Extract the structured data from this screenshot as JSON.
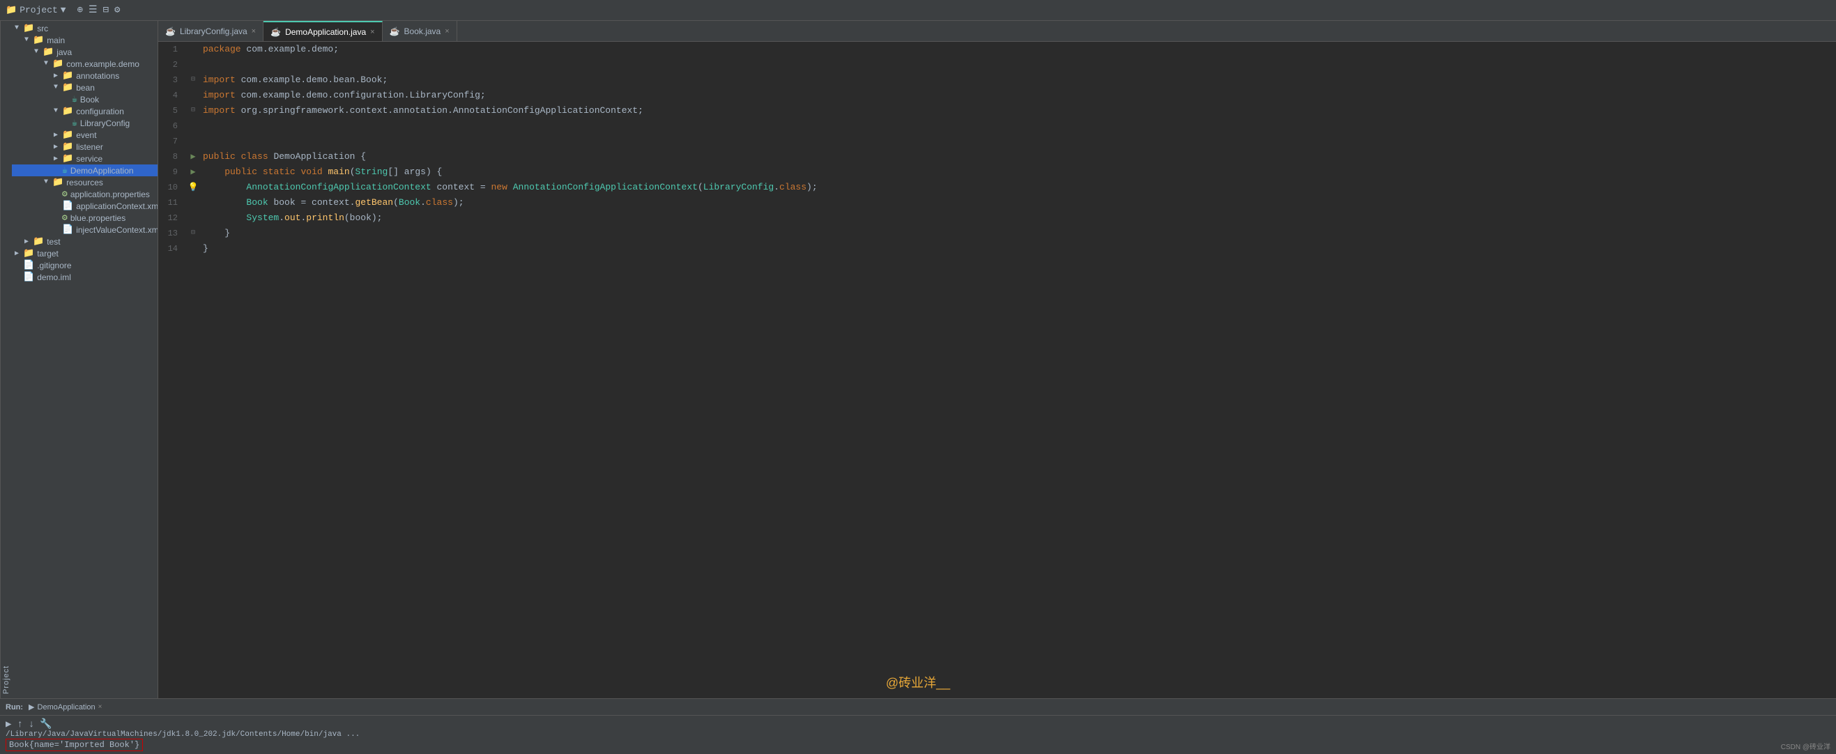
{
  "titleBar": {
    "projectLabel": "Project",
    "dropdownIcon": "▼",
    "icons": [
      "⊕",
      "≡",
      "≠",
      "⚙"
    ]
  },
  "sidebar": {
    "verticalLabel": "Project",
    "tree": [
      {
        "id": "src",
        "label": "src",
        "type": "folder-src",
        "depth": 0,
        "expanded": true,
        "arrow": "▼"
      },
      {
        "id": "main",
        "label": "main",
        "type": "folder",
        "depth": 1,
        "expanded": true,
        "arrow": "▼"
      },
      {
        "id": "java",
        "label": "java",
        "type": "folder",
        "depth": 2,
        "expanded": true,
        "arrow": "▼"
      },
      {
        "id": "com.example.demo",
        "label": "com.example.demo",
        "type": "folder",
        "depth": 3,
        "expanded": true,
        "arrow": "▼"
      },
      {
        "id": "annotations",
        "label": "annotations",
        "type": "folder",
        "depth": 4,
        "expanded": false,
        "arrow": "▶"
      },
      {
        "id": "bean",
        "label": "bean",
        "type": "folder",
        "depth": 4,
        "expanded": true,
        "arrow": "▼"
      },
      {
        "id": "Book",
        "label": "Book",
        "type": "java",
        "depth": 5,
        "expanded": false,
        "arrow": ""
      },
      {
        "id": "configuration",
        "label": "configuration",
        "type": "folder",
        "depth": 4,
        "expanded": true,
        "arrow": "▼"
      },
      {
        "id": "LibraryConfig",
        "label": "LibraryConfig",
        "type": "java",
        "depth": 5,
        "expanded": false,
        "arrow": ""
      },
      {
        "id": "event",
        "label": "event",
        "type": "folder",
        "depth": 4,
        "expanded": false,
        "arrow": "▶"
      },
      {
        "id": "listener",
        "label": "listener",
        "type": "folder",
        "depth": 4,
        "expanded": false,
        "arrow": "▶"
      },
      {
        "id": "service",
        "label": "service",
        "type": "folder",
        "depth": 4,
        "expanded": false,
        "arrow": "▶"
      },
      {
        "id": "DemoApplication",
        "label": "DemoApplication",
        "type": "java",
        "depth": 4,
        "expanded": false,
        "arrow": "",
        "selected": true
      },
      {
        "id": "resources",
        "label": "resources",
        "type": "folder-res",
        "depth": 3,
        "expanded": true,
        "arrow": "▼"
      },
      {
        "id": "application.properties",
        "label": "application.properties",
        "type": "props",
        "depth": 4,
        "expanded": false,
        "arrow": ""
      },
      {
        "id": "applicationContext.xml",
        "label": "applicationContext.xml",
        "type": "xml",
        "depth": 4,
        "expanded": false,
        "arrow": ""
      },
      {
        "id": "blue.properties",
        "label": "blue.properties",
        "type": "props",
        "depth": 4,
        "expanded": false,
        "arrow": ""
      },
      {
        "id": "injectValueContext.xml",
        "label": "injectValueContext.xml",
        "type": "xml",
        "depth": 4,
        "expanded": false,
        "arrow": ""
      },
      {
        "id": "test",
        "label": "test",
        "type": "folder",
        "depth": 1,
        "expanded": false,
        "arrow": "▶"
      },
      {
        "id": "target",
        "label": "target",
        "type": "folder",
        "depth": 0,
        "expanded": false,
        "arrow": "▶"
      },
      {
        "id": ".gitignore",
        "label": ".gitignore",
        "type": "gitignore",
        "depth": 0,
        "expanded": false,
        "arrow": ""
      },
      {
        "id": "demo.iml",
        "label": "demo.iml",
        "type": "iml",
        "depth": 0,
        "expanded": false,
        "arrow": ""
      }
    ]
  },
  "tabs": [
    {
      "id": "LibraryConfig",
      "label": "LibraryConfig.java",
      "icon": "☕",
      "active": false,
      "closeable": true
    },
    {
      "id": "DemoApplication",
      "label": "DemoApplication.java",
      "icon": "☕",
      "active": true,
      "closeable": true
    },
    {
      "id": "Book",
      "label": "Book.java",
      "icon": "☕",
      "active": false,
      "closeable": true
    }
  ],
  "codeLines": [
    {
      "num": 1,
      "gutter": "",
      "content": "package com.example.demo;"
    },
    {
      "num": 2,
      "gutter": "",
      "content": ""
    },
    {
      "num": 3,
      "gutter": "fold",
      "content": "import com.example.demo.bean.Book;"
    },
    {
      "num": 4,
      "gutter": "",
      "content": "import com.example.demo.configuration.LibraryConfig;"
    },
    {
      "num": 5,
      "gutter": "fold",
      "content": "import org.springframework.context.annotation.AnnotationConfigApplicationContext;"
    },
    {
      "num": 6,
      "gutter": "",
      "content": ""
    },
    {
      "num": 7,
      "gutter": "",
      "content": ""
    },
    {
      "num": 8,
      "gutter": "arrow",
      "content": "public class DemoApplication {"
    },
    {
      "num": 9,
      "gutter": "arrow",
      "content": "    public static void main(String[] args) {"
    },
    {
      "num": 10,
      "gutter": "bulb",
      "content": "        AnnotationConfigApplicationContext context = new AnnotationConfigApplicationContext(LibraryConfig.class);"
    },
    {
      "num": 11,
      "gutter": "",
      "content": "        Book book = context.getBean(Book.class);"
    },
    {
      "num": 12,
      "gutter": "",
      "content": "        System.out.println(book);"
    },
    {
      "num": 13,
      "gutter": "fold",
      "content": "    }"
    },
    {
      "num": 14,
      "gutter": "",
      "content": "}"
    }
  ],
  "watermark": "@砖业洋__",
  "bottomPanel": {
    "runLabel": "Run:",
    "tabLabel": "DemoApplication",
    "runPath": "/Library/Java/JavaVirtualMachines/jdk1.8.0_202.jdk/Contents/Home/bin/java ...",
    "output": "Book{name='Imported Book'}"
  },
  "csdnLabel": "CSDN @砖业洋"
}
